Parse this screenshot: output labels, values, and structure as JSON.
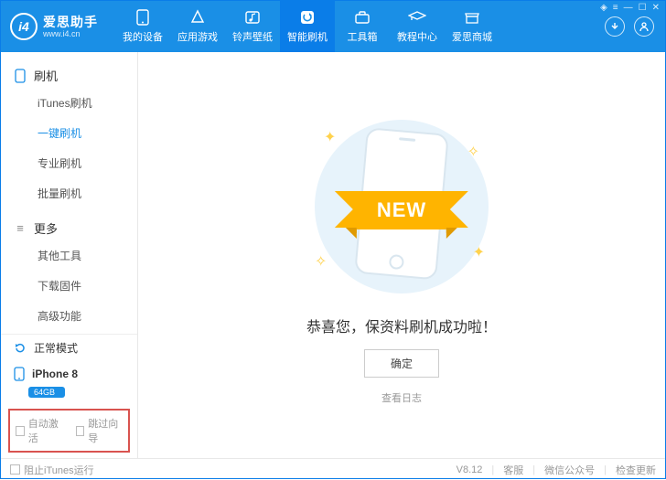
{
  "app": {
    "name": "爱思助手",
    "url": "www.i4.cn",
    "logo_text": "i4"
  },
  "window_controls": {
    "skin": "skin-icon",
    "menu": "menu-icon",
    "min": "minimize-icon",
    "max": "maximize-icon",
    "close": "close-icon"
  },
  "top_tabs": [
    {
      "label": "我的设备",
      "icon": "device-icon"
    },
    {
      "label": "应用游戏",
      "icon": "apps-icon"
    },
    {
      "label": "铃声壁纸",
      "icon": "music-icon"
    },
    {
      "label": "智能刷机",
      "icon": "flash-icon",
      "active": true
    },
    {
      "label": "工具箱",
      "icon": "toolbox-icon"
    },
    {
      "label": "教程中心",
      "icon": "tutorial-icon"
    },
    {
      "label": "爱思商城",
      "icon": "store-icon"
    }
  ],
  "sidebar": {
    "groups": [
      {
        "title": "刷机",
        "icon": "phone-icon",
        "items": [
          "iTunes刷机",
          "一键刷机",
          "专业刷机",
          "批量刷机"
        ],
        "active_index": 1
      },
      {
        "title": "更多",
        "icon": "more-icon",
        "items": [
          "其他工具",
          "下载固件",
          "高级功能"
        ],
        "active_index": -1
      }
    ],
    "status": {
      "label": "正常模式",
      "icon": "refresh-icon"
    },
    "device": {
      "name": "iPhone 8",
      "storage": "64GB",
      "icon": "iphone-icon"
    },
    "bottom_checks": [
      "自动激活",
      "跳过向导"
    ]
  },
  "main": {
    "ribbon_text": "NEW",
    "success_text": "恭喜您，保资料刷机成功啦！",
    "ok_button": "确定",
    "log_link": "查看日志"
  },
  "footer": {
    "block_itunes": "阻止iTunes运行",
    "version": "V8.12",
    "links": [
      "客服",
      "微信公众号",
      "检查更新"
    ]
  },
  "colors": {
    "primary": "#1a8fe6",
    "accent_red": "#d9534f",
    "ribbon": "#ffb400"
  }
}
